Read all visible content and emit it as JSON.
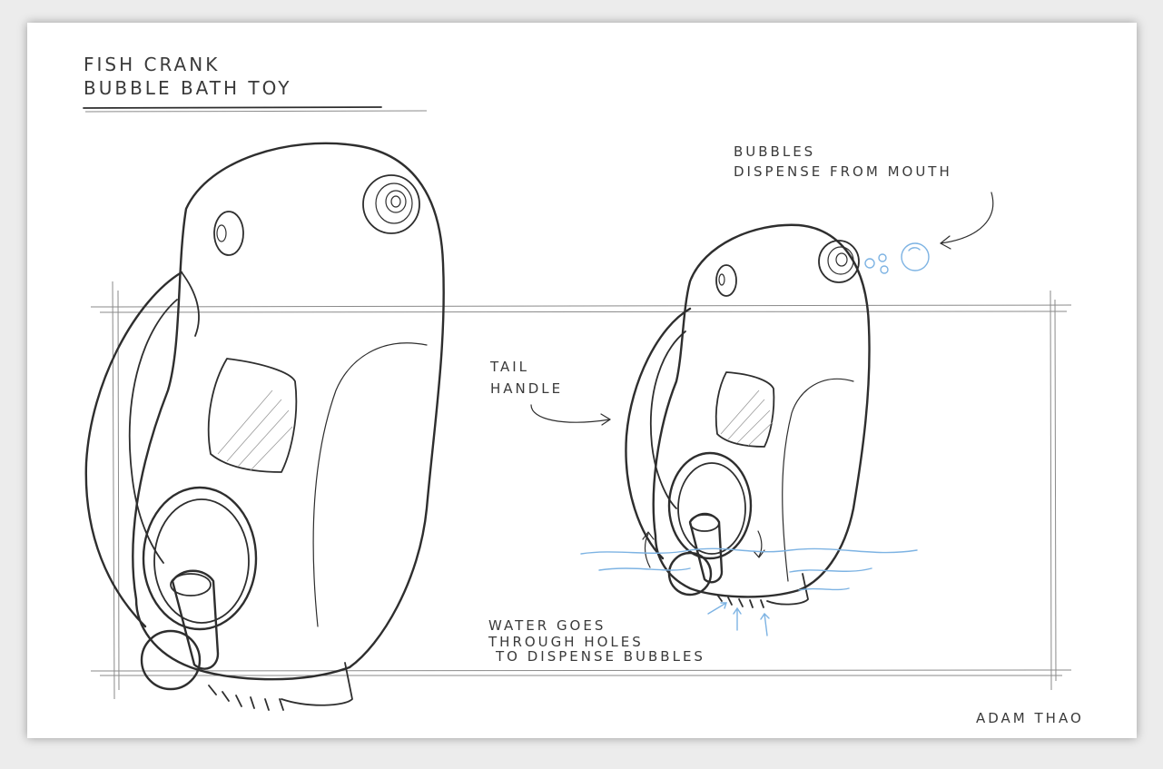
{
  "title": {
    "line1": "FISH CRANK",
    "line2": "BUBBLE BATH TOY"
  },
  "annotations": {
    "bubbles_line1": "BUBBLES",
    "bubbles_line2": "DISPENSE FROM MOUTH",
    "tail_line1": "TAIL",
    "tail_line2": "HANDLE",
    "water_line1": "WATER GOES",
    "water_line2": "THROUGH HOLES",
    "water_line3": "TO DISPENSE BUBBLES"
  },
  "signature": "ADAM THAO",
  "colors": {
    "ink": "#2e2e2e",
    "water": "#7db3e3",
    "paper": "#ffffff",
    "background": "#ececec"
  }
}
